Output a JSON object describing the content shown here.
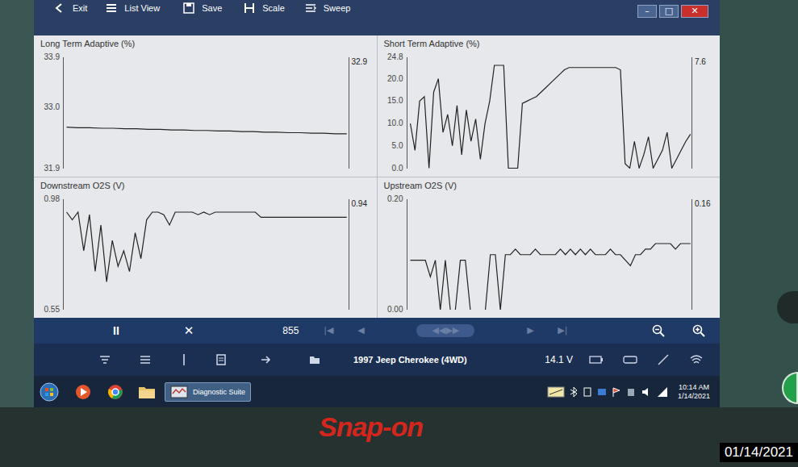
{
  "window": {
    "controls": [
      {
        "label": "–",
        "kind": "button"
      },
      {
        "label": "□",
        "kind": "button"
      },
      {
        "label": "✕",
        "kind": "close"
      }
    ]
  },
  "toolbar": {
    "items": [
      {
        "label": "Exit"
      },
      {
        "label": "List View"
      },
      {
        "label": "Save"
      },
      {
        "label": "Scale"
      },
      {
        "label": "Sweep"
      }
    ]
  },
  "charts": [
    {
      "title": "Long Term Adaptive (%)",
      "min": 31.9,
      "max": 33.9,
      "reading": "32.9",
      "ticks": [
        {
          "label": "33.9",
          "value": 33.9
        },
        {
          "label": "33.0",
          "value": 33.0
        },
        {
          "label": "31.9",
          "value": 31.9
        }
      ],
      "values": [
        32.64,
        32.63,
        32.63,
        32.62,
        32.62,
        32.61,
        32.61,
        32.6,
        32.6,
        32.59,
        32.59,
        32.58,
        32.58,
        32.57,
        32.57,
        32.56,
        32.56,
        32.55,
        32.55,
        32.54,
        32.54,
        32.53,
        32.53,
        32.52,
        32.52
      ]
    },
    {
      "title": "Short Term Adaptive (%)",
      "min": 0.0,
      "max": 24.8,
      "reading": "7.6",
      "ticks": [
        {
          "label": "24.8",
          "value": 24.8
        },
        {
          "label": "20.0",
          "value": 20.0
        },
        {
          "label": "15.0",
          "value": 15.0
        },
        {
          "label": "10.0",
          "value": 10.0
        },
        {
          "label": "5.0",
          "value": 5.0
        },
        {
          "label": "0.0",
          "value": 0.0
        }
      ],
      "values": [
        10,
        4,
        15,
        16,
        0,
        17,
        20,
        8,
        12,
        5,
        14,
        3,
        13,
        6,
        11,
        2,
        10,
        15,
        23,
        23,
        23,
        0,
        0,
        0,
        14.5,
        15,
        15.5,
        16,
        17,
        18,
        19,
        20,
        21,
        22,
        22.5,
        22.5,
        22.5,
        22.5,
        22.5,
        22.5,
        22.5,
        22.5,
        22.5,
        22.5,
        22.5,
        22,
        1,
        0,
        6,
        0,
        3,
        7,
        0,
        2,
        4,
        8,
        0,
        2,
        4,
        6,
        7.6
      ]
    },
    {
      "title": "Downstream O2S (V)",
      "min": 0.55,
      "max": 0.98,
      "reading": "0.94",
      "ticks": [
        {
          "label": "0.98",
          "value": 0.98
        },
        {
          "label": "0.55",
          "value": 0.55
        }
      ],
      "values": [
        0.93,
        0.9,
        0.93,
        0.78,
        0.92,
        0.7,
        0.88,
        0.66,
        0.82,
        0.72,
        0.78,
        0.7,
        0.85,
        0.75,
        0.9,
        0.93,
        0.93,
        0.92,
        0.88,
        0.93,
        0.93,
        0.93,
        0.93,
        0.92,
        0.93,
        0.92,
        0.93,
        0.93,
        0.93,
        0.93,
        0.93,
        0.93,
        0.93,
        0.93,
        0.91,
        0.91,
        0.91,
        0.91,
        0.91,
        0.91,
        0.91,
        0.91,
        0.91,
        0.91,
        0.91,
        0.91,
        0.91,
        0.91,
        0.91,
        0.91
      ]
    },
    {
      "title": "Upstream O2S (V)",
      "min": 0.0,
      "max": 0.2,
      "reading": "0.16",
      "ticks": [
        {
          "label": "0.20",
          "value": 0.2
        },
        {
          "label": "0.00",
          "value": 0.0
        }
      ],
      "values": [
        0.09,
        0.09,
        0.09,
        0.09,
        0.06,
        0.09,
        0.0,
        0.09,
        0.0,
        0.0,
        0.09,
        0.09,
        0.0,
        0.0,
        0.0,
        0.0,
        0.1,
        0.1,
        0.0,
        0.1,
        0.1,
        0.11,
        0.1,
        0.1,
        0.1,
        0.11,
        0.1,
        0.1,
        0.1,
        0.1,
        0.11,
        0.1,
        0.11,
        0.1,
        0.11,
        0.1,
        0.11,
        0.1,
        0.1,
        0.1,
        0.11,
        0.1,
        0.1,
        0.09,
        0.08,
        0.1,
        0.1,
        0.11,
        0.11,
        0.12,
        0.12,
        0.12,
        0.12,
        0.11,
        0.12,
        0.12,
        0.12
      ]
    }
  ],
  "playback": {
    "pause": "II",
    "stop": "✕",
    "frame": "855",
    "controls": [
      {
        "label": "|◀",
        "kind": "button",
        "disabled": true
      },
      {
        "label": "◀",
        "kind": "button",
        "disabled": true
      },
      {
        "label": "◀◀▶▶",
        "kind": "slider",
        "disabled": true
      },
      {
        "label": "▶",
        "kind": "button",
        "disabled": true
      },
      {
        "label": "▶|",
        "kind": "button",
        "disabled": true
      }
    ]
  },
  "vehicle": {
    "name": "1997 Jeep Cherokee (4WD)",
    "battery": "14.1 V"
  },
  "taskbar": {
    "app": "Diagnostic Suite",
    "time": "10:14 AM",
    "date": "1/14/2021"
  },
  "brand": "Snap-on",
  "photo_date": "01/14/2021"
}
